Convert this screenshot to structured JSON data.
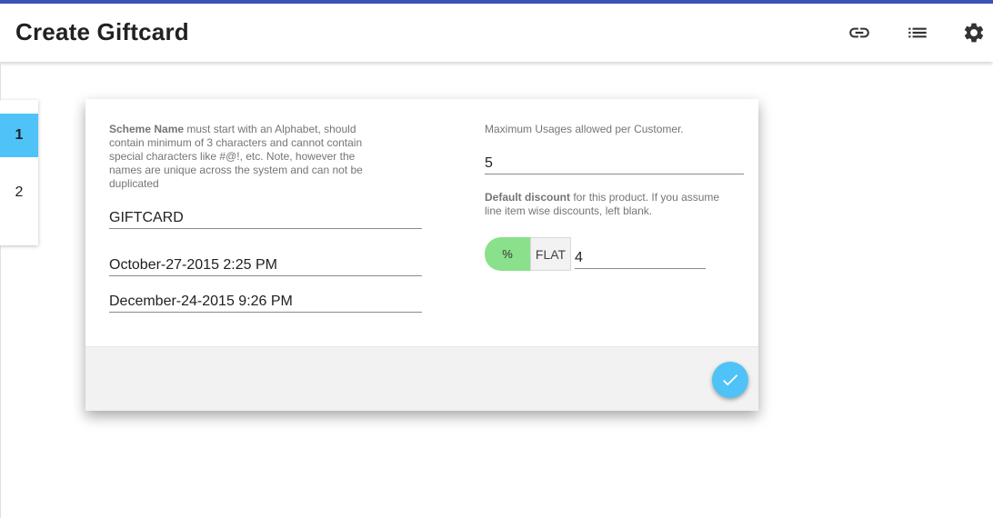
{
  "header": {
    "title": "Create Giftcard",
    "icons": [
      "link-icon",
      "list-icon",
      "gear-icon"
    ]
  },
  "stepper": {
    "steps": [
      {
        "label": "1",
        "active": true
      },
      {
        "label": "2",
        "active": false
      }
    ]
  },
  "form": {
    "scheme_name_hint_bold": "Scheme Name",
    "scheme_name_hint_rest": " must start with an Alphabet, should contain minimum of 3 characters and cannot contain special characters like #@!, etc. Note, however the names are unique across the system and can not be duplicated",
    "scheme_name_value": "GIFTCARD",
    "start_date_value": "October-27-2015 2:25 PM",
    "end_date_value": "December-24-2015 9:26 PM",
    "max_usage_hint": "Maximum Usages allowed per Customer.",
    "max_usage_value": "5",
    "discount_hint_bold": "Default discount",
    "discount_hint_rest": " for this product. If you assume line item wise discounts, left blank.",
    "discount_type_percent_label": "%",
    "discount_type_flat_label": "FLAT",
    "discount_value": "4"
  },
  "colors": {
    "accent_bar": "#3f51b5",
    "active_step": "#4fc3f7",
    "toggle_selected": "#8be08b",
    "fab": "#4fc3f7"
  },
  "footer": {
    "submit_icon": "check-icon"
  }
}
